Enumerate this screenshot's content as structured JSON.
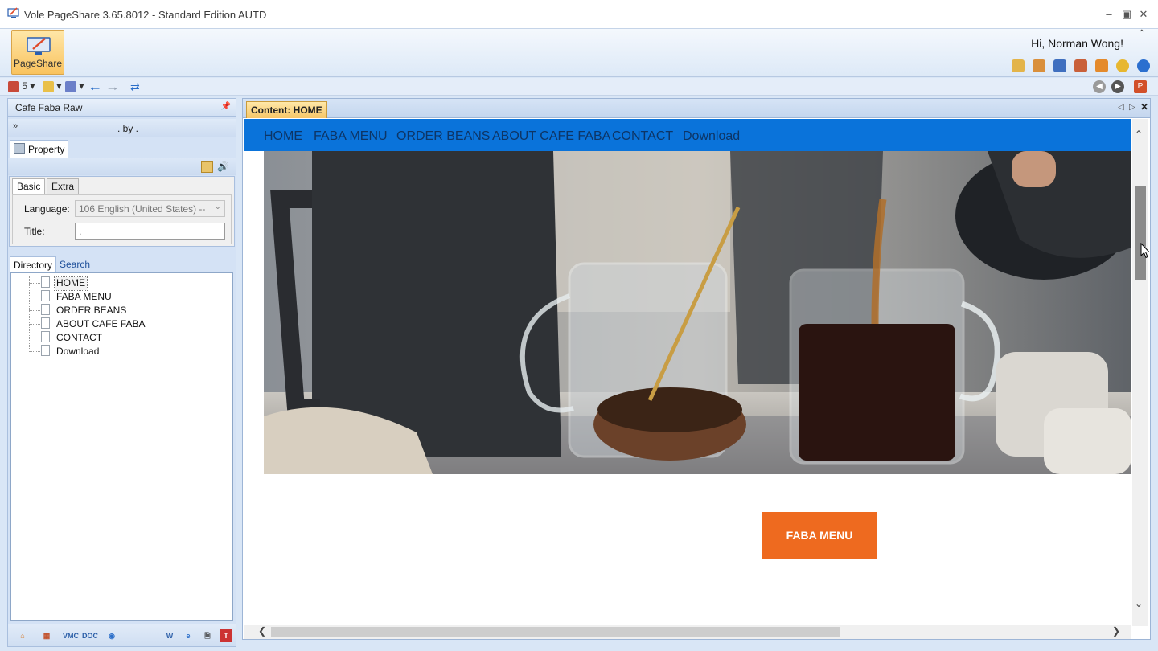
{
  "window": {
    "title": "Vole PageShare  3.65.8012 - Standard Edition AUTD"
  },
  "ribbon": {
    "pageshare_label": "PageShare",
    "greeting": "Hi, Norman Wong!"
  },
  "toolbar": {
    "count": "5"
  },
  "left_panel": {
    "header": "Cafe Faba Raw",
    "subtitle": ". by .",
    "property_tab": "Property",
    "tabs": {
      "basic": "Basic",
      "extra": "Extra"
    },
    "language_label": "Language:",
    "language_value": "106 English (United States) --",
    "title_label": "Title:",
    "title_value": ".",
    "dir_tabs": {
      "directory": "Directory",
      "search": "Search"
    },
    "tree": [
      {
        "label": "HOME"
      },
      {
        "label": "FABA MENU"
      },
      {
        "label": "ORDER BEANS"
      },
      {
        "label": "ABOUT CAFE FABA"
      },
      {
        "label": "CONTACT"
      },
      {
        "label": "Download"
      }
    ]
  },
  "content": {
    "tab_title": "Content: HOME",
    "nav": [
      "HOME",
      "FABA MENU",
      "ORDER BEANS",
      "ABOUT CAFE FABA",
      "CONTACT",
      "Download"
    ],
    "cta_label": "FABA MENU"
  },
  "colors": {
    "nav_bg": "#0a73da",
    "nav_text": "#0d3566",
    "cta_bg": "#ee6a1f",
    "tab_active": "#f7c667"
  }
}
